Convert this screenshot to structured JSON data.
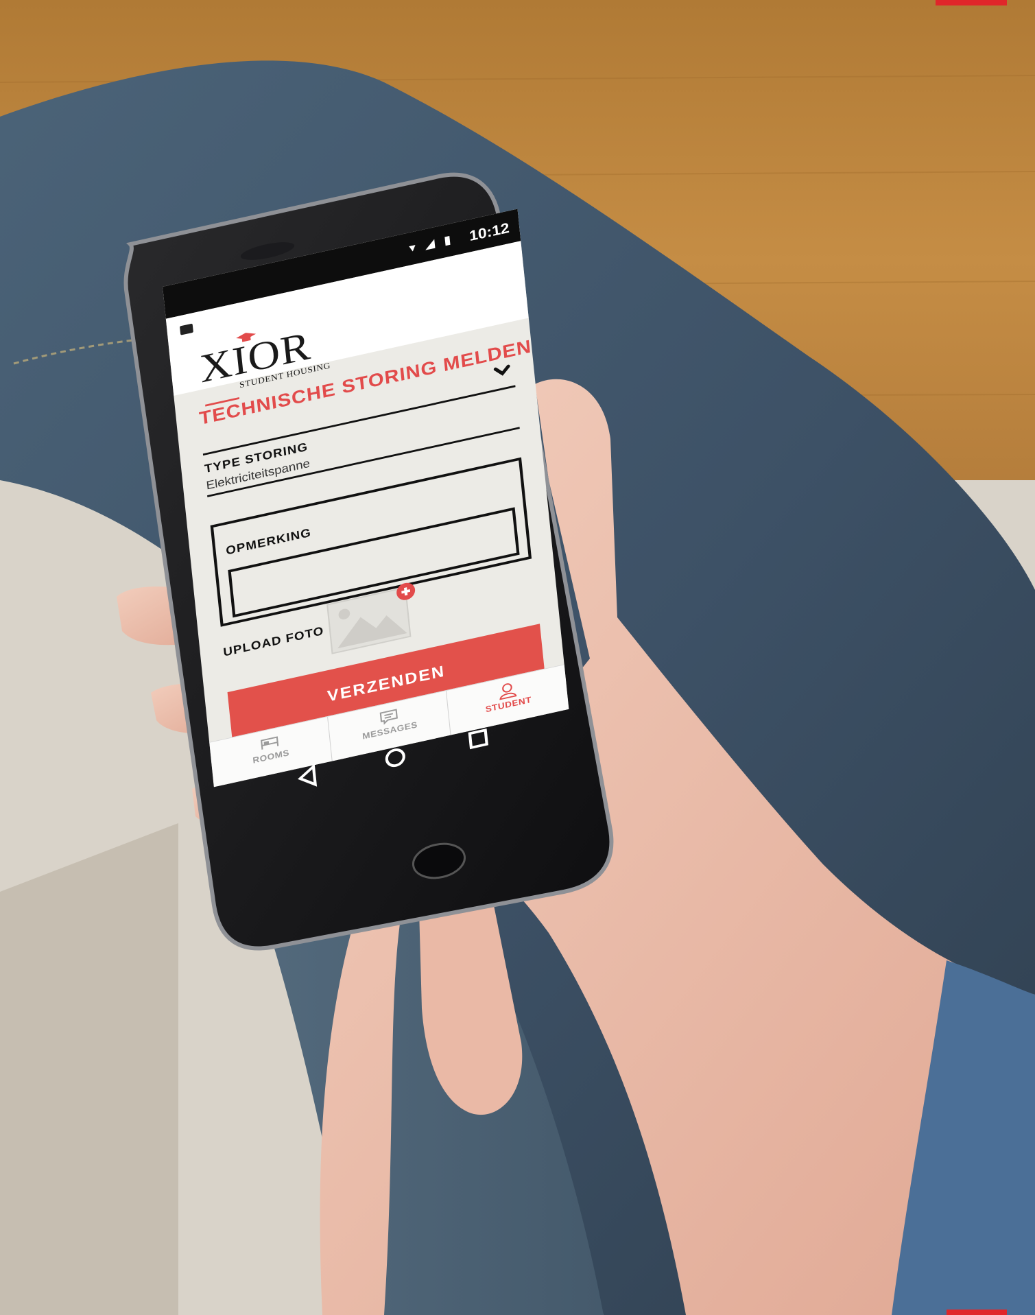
{
  "status_bar": {
    "time": "10:12",
    "icons": [
      "wifi-icon",
      "signal-icon",
      "battery-icon"
    ]
  },
  "app": {
    "logo": {
      "word": "XIOR",
      "subtitle": "STUDENT HOUSING"
    },
    "page_title": "TECHNISCHE STORING MELDEN",
    "type_field": {
      "label": "TYPE STORING",
      "value": "Elektriciteitspanne"
    },
    "remark_field": {
      "label": "OPMERKING",
      "value": ""
    },
    "upload": {
      "label": "UPLOAD FOTO"
    },
    "submit_label": "VERZENDEN",
    "tabs": [
      {
        "label": "ROOMS",
        "icon": "bed-icon",
        "active": false
      },
      {
        "label": "MESSAGES",
        "icon": "chat-icon",
        "active": false
      },
      {
        "label": "STUDENT",
        "icon": "person-icon",
        "active": true
      }
    ],
    "nav_buttons": [
      "back-icon",
      "home-icon",
      "recents-icon"
    ]
  },
  "colors": {
    "accent": "#e24b4b",
    "brand_bar": "#e0262a",
    "screen_bg": "#ecebe6"
  }
}
